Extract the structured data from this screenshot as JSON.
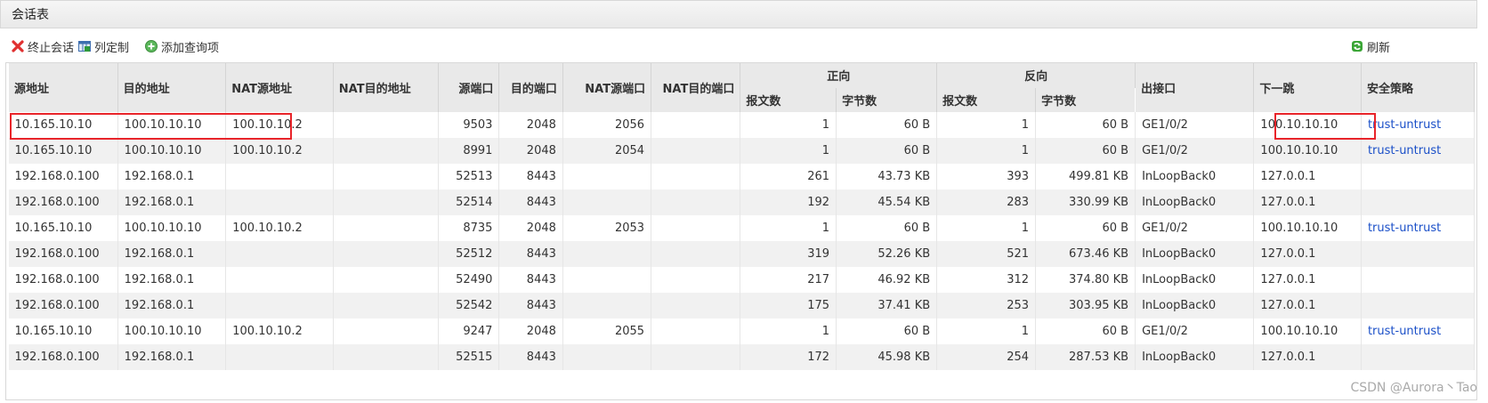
{
  "panel_title": "会话表",
  "toolbar": {
    "terminate_label": "终止会话",
    "customize_label": "列定制",
    "add_query_label": "添加查询项",
    "refresh_label": "刷新"
  },
  "table": {
    "headers": {
      "src": "源地址",
      "dst": "目的地址",
      "nat_src": "NAT源地址",
      "nat_dst": "NAT目的地址",
      "src_port": "源端口",
      "dst_port": "目的端口",
      "nat_src_port": "NAT源端口",
      "nat_dst_port": "NAT目的端口",
      "forward": "正向",
      "reverse": "反向",
      "packets": "报文数",
      "bytes": "字节数",
      "out_if": "出接口",
      "next_hop": "下一跳",
      "policy": "安全策略"
    },
    "rows": [
      {
        "src": "10.165.10.10",
        "dst": "100.10.10.10",
        "nat_src": "100.10.10.2",
        "nat_dst": "",
        "sport": "9503",
        "dport": "2048",
        "nsport": "2056",
        "ndport": "",
        "fpkt": "1",
        "fbytes": "60 B",
        "rpkt": "1",
        "rbytes": "60 B",
        "oif": "GE1/0/2",
        "nh": "100.10.10.10",
        "policy": "trust-untrust"
      },
      {
        "src": "10.165.10.10",
        "dst": "100.10.10.10",
        "nat_src": "100.10.10.2",
        "nat_dst": "",
        "sport": "8991",
        "dport": "2048",
        "nsport": "2054",
        "ndport": "",
        "fpkt": "1",
        "fbytes": "60 B",
        "rpkt": "1",
        "rbytes": "60 B",
        "oif": "GE1/0/2",
        "nh": "100.10.10.10",
        "policy": "trust-untrust"
      },
      {
        "src": "192.168.0.100",
        "dst": "192.168.0.1",
        "nat_src": "",
        "nat_dst": "",
        "sport": "52513",
        "dport": "8443",
        "nsport": "",
        "ndport": "",
        "fpkt": "261",
        "fbytes": "43.73 KB",
        "rpkt": "393",
        "rbytes": "499.81 KB",
        "oif": "InLoopBack0",
        "nh": "127.0.0.1",
        "policy": ""
      },
      {
        "src": "192.168.0.100",
        "dst": "192.168.0.1",
        "nat_src": "",
        "nat_dst": "",
        "sport": "52514",
        "dport": "8443",
        "nsport": "",
        "ndport": "",
        "fpkt": "192",
        "fbytes": "45.54 KB",
        "rpkt": "283",
        "rbytes": "330.99 KB",
        "oif": "InLoopBack0",
        "nh": "127.0.0.1",
        "policy": ""
      },
      {
        "src": "10.165.10.10",
        "dst": "100.10.10.10",
        "nat_src": "100.10.10.2",
        "nat_dst": "",
        "sport": "8735",
        "dport": "2048",
        "nsport": "2053",
        "ndport": "",
        "fpkt": "1",
        "fbytes": "60 B",
        "rpkt": "1",
        "rbytes": "60 B",
        "oif": "GE1/0/2",
        "nh": "100.10.10.10",
        "policy": "trust-untrust"
      },
      {
        "src": "192.168.0.100",
        "dst": "192.168.0.1",
        "nat_src": "",
        "nat_dst": "",
        "sport": "52512",
        "dport": "8443",
        "nsport": "",
        "ndport": "",
        "fpkt": "319",
        "fbytes": "52.26 KB",
        "rpkt": "521",
        "rbytes": "673.46 KB",
        "oif": "InLoopBack0",
        "nh": "127.0.0.1",
        "policy": ""
      },
      {
        "src": "192.168.0.100",
        "dst": "192.168.0.1",
        "nat_src": "",
        "nat_dst": "",
        "sport": "52490",
        "dport": "8443",
        "nsport": "",
        "ndport": "",
        "fpkt": "217",
        "fbytes": "46.92 KB",
        "rpkt": "312",
        "rbytes": "374.80 KB",
        "oif": "InLoopBack0",
        "nh": "127.0.0.1",
        "policy": ""
      },
      {
        "src": "192.168.0.100",
        "dst": "192.168.0.1",
        "nat_src": "",
        "nat_dst": "",
        "sport": "52542",
        "dport": "8443",
        "nsport": "",
        "ndport": "",
        "fpkt": "175",
        "fbytes": "37.41 KB",
        "rpkt": "253",
        "rbytes": "303.95 KB",
        "oif": "InLoopBack0",
        "nh": "127.0.0.1",
        "policy": ""
      },
      {
        "src": "10.165.10.10",
        "dst": "100.10.10.10",
        "nat_src": "100.10.10.2",
        "nat_dst": "",
        "sport": "9247",
        "dport": "2048",
        "nsport": "2055",
        "ndport": "",
        "fpkt": "1",
        "fbytes": "60 B",
        "rpkt": "1",
        "rbytes": "60 B",
        "oif": "GE1/0/2",
        "nh": "100.10.10.10",
        "policy": "trust-untrust"
      },
      {
        "src": "192.168.0.100",
        "dst": "192.168.0.1",
        "nat_src": "",
        "nat_dst": "",
        "sport": "52515",
        "dport": "8443",
        "nsport": "",
        "ndport": "",
        "fpkt": "172",
        "fbytes": "45.98 KB",
        "rpkt": "254",
        "rbytes": "287.53 KB",
        "oif": "InLoopBack0",
        "nh": "127.0.0.1",
        "policy": ""
      }
    ]
  },
  "watermark": "CSDN @Aurora丶Tao",
  "colors": {
    "highlight": "#e8242a",
    "link": "#1a4fc8",
    "refresh_icon": "#3aa535",
    "delete_icon": "#e03030"
  },
  "icons": {
    "terminate": "red-x-icon",
    "customize": "column-grid-icon",
    "add_query": "green-plus-icon",
    "refresh": "refresh-icon"
  }
}
